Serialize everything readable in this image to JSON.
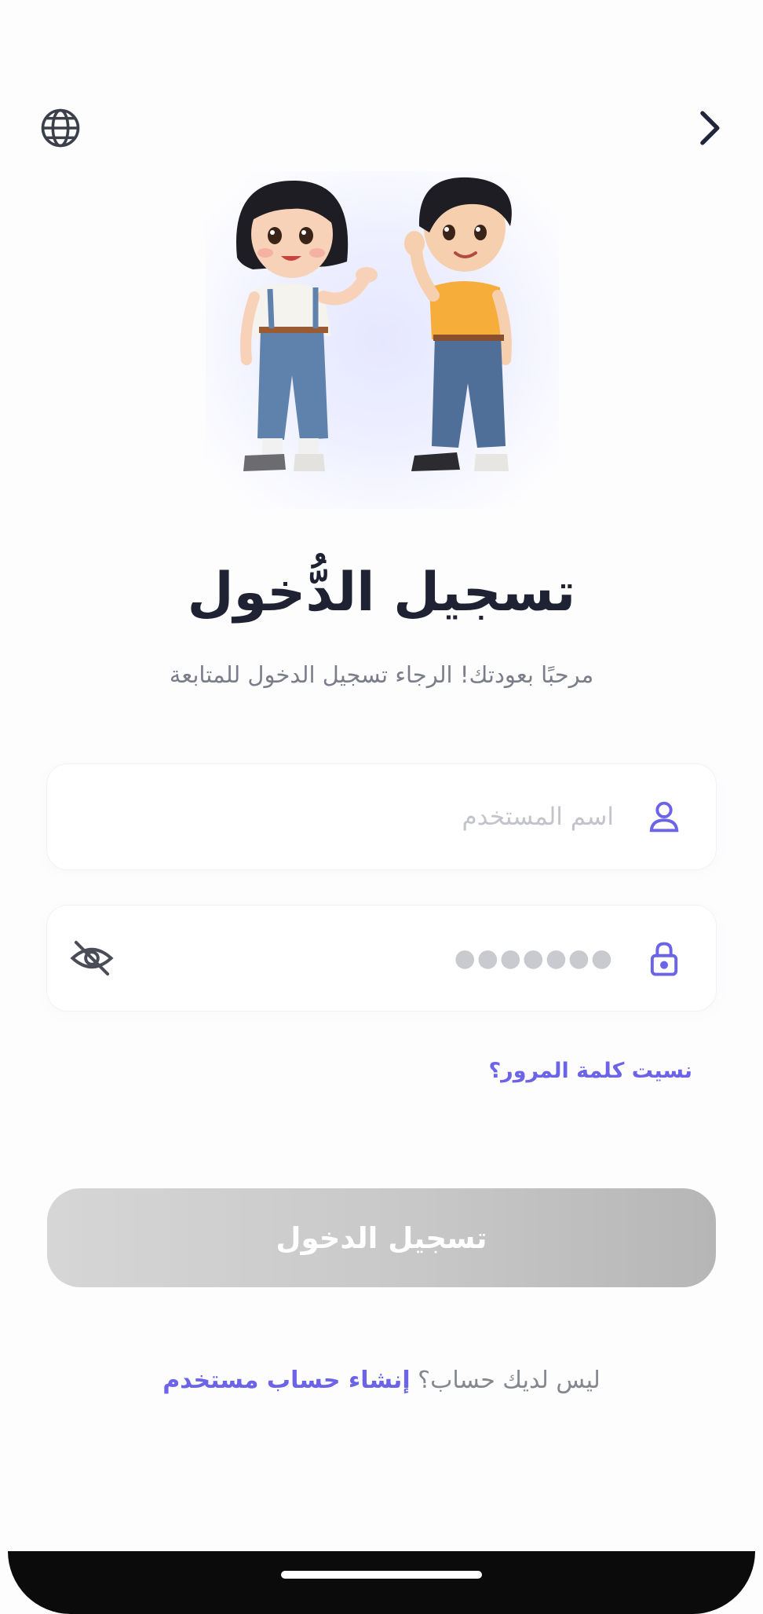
{
  "top_bar": {
    "language_icon": "globe-icon",
    "nav_icon": "chevron-right-icon"
  },
  "hero": {
    "illustration": "two-kids-waving-illustration"
  },
  "title": "تسجيل الدُّخول",
  "subtitle": "مرحبًا بعودتك! الرجاء تسجيل الدخول للمتابعة",
  "username": {
    "placeholder": "اسم المستخدم",
    "icon": "user-icon"
  },
  "password": {
    "value_masked": "●●●●●●●",
    "icon": "lock-icon",
    "toggle_icon": "eye-off-icon"
  },
  "forgot_password": "نسيت كلمة المرور؟",
  "login_button": "تسجيل الدخول",
  "signup": {
    "question": "ليس لديك حساب؟",
    "link": "إنشاء حساب مستخدم"
  },
  "colors": {
    "accent": "#6b63e8",
    "title": "#1e2233",
    "button_disabled": "#c8c8c8"
  }
}
